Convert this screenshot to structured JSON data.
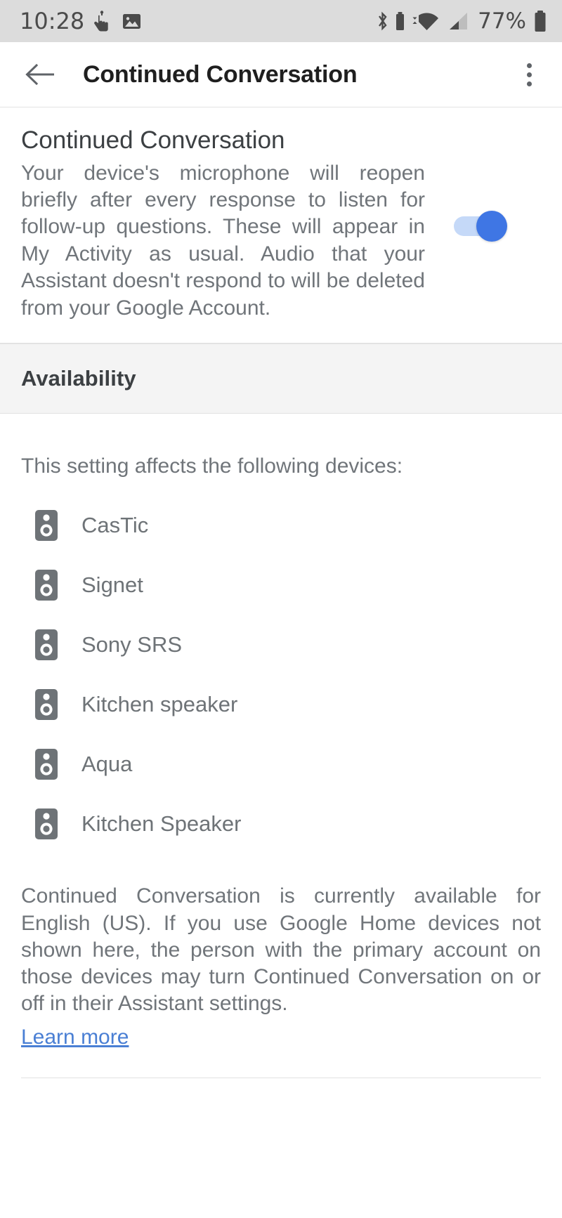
{
  "status_bar": {
    "time": "10:28",
    "battery_percent": "77%",
    "icons": [
      "touch-pointer-icon",
      "photo-icon",
      "bluetooth-icon",
      "small-battery-icon",
      "wifi-icon",
      "cellular-signal-icon",
      "battery-icon"
    ]
  },
  "app_bar": {
    "back_icon": "arrow-back-icon",
    "title": "Continued Conversation",
    "overflow_icon": "more-vert-icon"
  },
  "setting": {
    "title": "Continued Conversation",
    "description": "Your device's microphone will reopen briefly after every response to listen for follow-up questions. These will appear in My Activity as usual. Audio that your Assistant doesn't respond to will be deleted from your Google Account.",
    "toggle_state": "on",
    "toggle_track_color": "#c5d9f8",
    "toggle_thumb_color": "#3f76e4"
  },
  "availability": {
    "header": "Availability",
    "intro": "This setting affects the following devices:",
    "devices": [
      {
        "name": "CasTic",
        "icon": "speaker-icon"
      },
      {
        "name": "Signet",
        "icon": "speaker-icon"
      },
      {
        "name": "Sony SRS",
        "icon": "speaker-icon"
      },
      {
        "name": "Kitchen speaker",
        "icon": "speaker-icon"
      },
      {
        "name": "Aqua",
        "icon": "speaker-icon"
      },
      {
        "name": "Kitchen Speaker",
        "icon": "speaker-icon"
      }
    ],
    "footer_note": "Continued Conversation is currently available for English (US). If you use Google Home devices not shown here, the person with the primary account on those devices may turn Continued Conversation on or off in their Assistant settings.",
    "learn_more": "Learn more",
    "link_color": "#4a7fd4"
  }
}
